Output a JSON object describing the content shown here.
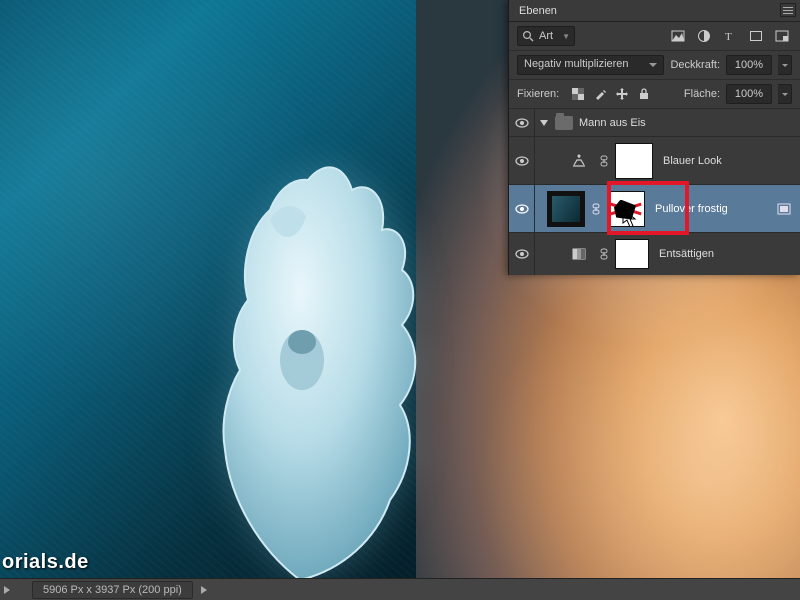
{
  "panel": {
    "title": "Ebenen",
    "filter_label": "Art",
    "blend_mode": "Negativ multiplizieren",
    "opacity_label": "Deckkraft:",
    "opacity_value": "100%",
    "fill_label": "Fläche:",
    "fill_value": "100%",
    "lock_label": "Fixieren:",
    "group_name": "Mann aus Eis",
    "layers": [
      {
        "name": "Blauer Look"
      },
      {
        "name": "Pullover frostig"
      },
      {
        "name": "Entsättigen"
      }
    ]
  },
  "status": {
    "doc_info": "5906 Px x 3937 Px (200 ppi)"
  },
  "watermark": "orials.de"
}
